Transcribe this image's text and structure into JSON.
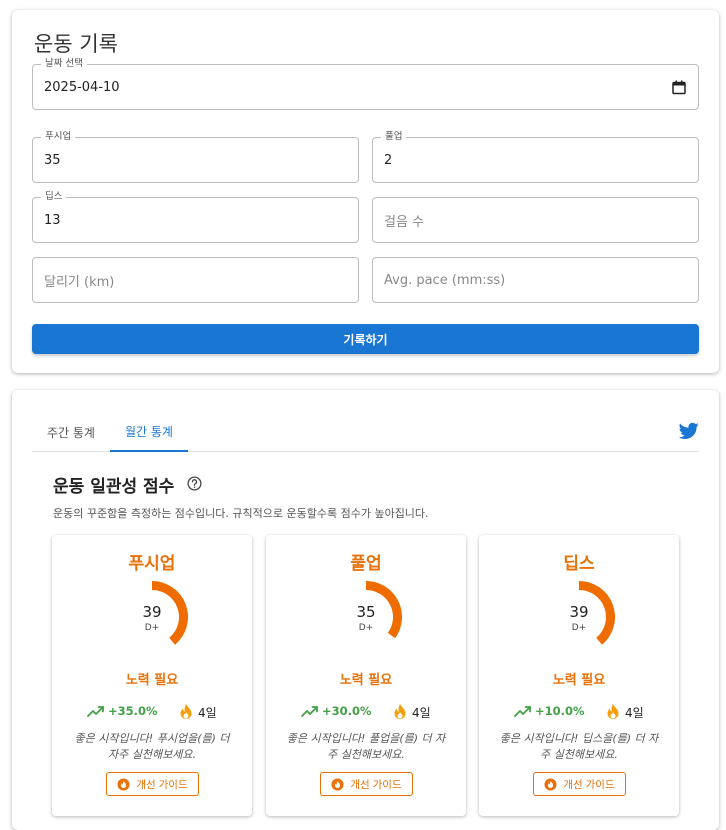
{
  "form": {
    "title": "운동 기록",
    "date": {
      "label": "날짜 선택",
      "value": "2025-04-10"
    },
    "pushups": {
      "label": "푸시업",
      "value": "35"
    },
    "pullups": {
      "label": "풀업",
      "value": "2"
    },
    "dips": {
      "label": "딥스",
      "value": "13"
    },
    "steps": {
      "placeholder": "걸음 수"
    },
    "running": {
      "placeholder": "달리기 (km)"
    },
    "pace": {
      "placeholder": "Avg. pace (mm:ss)"
    },
    "submit_label": "기록하기"
  },
  "stats": {
    "tabs": [
      {
        "label": "주간 통계",
        "active": false
      },
      {
        "label": "월간 통계",
        "active": true
      }
    ],
    "share_icon": "twitter-icon",
    "heading": "운동 일관성 점수",
    "description": "운동의 꾸준함을 측정하는 점수입니다. 규칙적으로 운동할수록 점수가 높아집니다.",
    "cards": [
      {
        "name": "푸시업",
        "score": "39",
        "grade": "D+",
        "score_fraction": 0.39,
        "status": "노력 필요",
        "trend": "+35.0%",
        "streak": "4일",
        "message": "좋은 시작입니다! 푸시업을(를) 더 자주 실천해보세요.",
        "guide_label": "개선 가이드"
      },
      {
        "name": "풀업",
        "score": "35",
        "grade": "D+",
        "score_fraction": 0.35,
        "status": "노력 필요",
        "trend": "+30.0%",
        "streak": "4일",
        "message": "좋은 시작입니다! 풀업을(를) 더 자주 실천해보세요.",
        "guide_label": "개선 가이드"
      },
      {
        "name": "딥스",
        "score": "39",
        "grade": "D+",
        "score_fraction": 0.39,
        "status": "노력 필요",
        "trend": "+10.0%",
        "streak": "4일",
        "message": "좋은 시작입니다! 딥스을(를) 더 자주 실천해보세요.",
        "guide_label": "개선 가이드"
      }
    ]
  },
  "colors": {
    "primary": "#1976d2",
    "accent_orange": "#e8710a",
    "trend_green": "#43a047",
    "twitter_blue": "#1da1f2"
  }
}
